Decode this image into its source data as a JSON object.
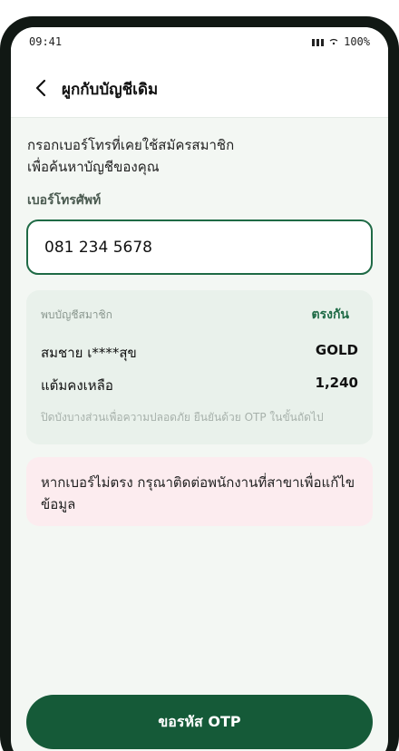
{
  "status_bar": {
    "time": "09:41",
    "battery": "100%"
  },
  "header": {
    "title": "ผูกกับบัญชีเดิม"
  },
  "form": {
    "description_line1": "กรอกเบอร์โทรที่เคยใช้สมัครสมาชิก",
    "description_line2": "เพื่อค้นหาบัญชีของคุณ",
    "phone_label": "เบอร์โทรศัพท์",
    "phone_value": "081 234 5678"
  },
  "account": {
    "found_label": "พบบัญชีสมาชิก",
    "match_label": "ตรงกัน",
    "name": "สมชาย เ****สุข",
    "tier": "GOLD",
    "points_label": "แต้มคงเหลือ",
    "points": "1,240",
    "note": "ปิดบังบางส่วนเพื่อความปลอดภัย ยืนยันด้วย OTP ในขั้นถัดไป"
  },
  "warning": {
    "text": "หากเบอร์ไม่ตรง กรุณาติดต่อพนักงานที่สาขาเพื่อแก้ไขข้อมูล"
  },
  "actions": {
    "otp_button": "ขอรหัส OTP"
  },
  "colors": {
    "primary": "#155a38",
    "accent": "#1e6a45",
    "card_bg": "#e9f1eb",
    "warning_bg": "#fcecef",
    "page_bg": "#f3f7f3"
  }
}
